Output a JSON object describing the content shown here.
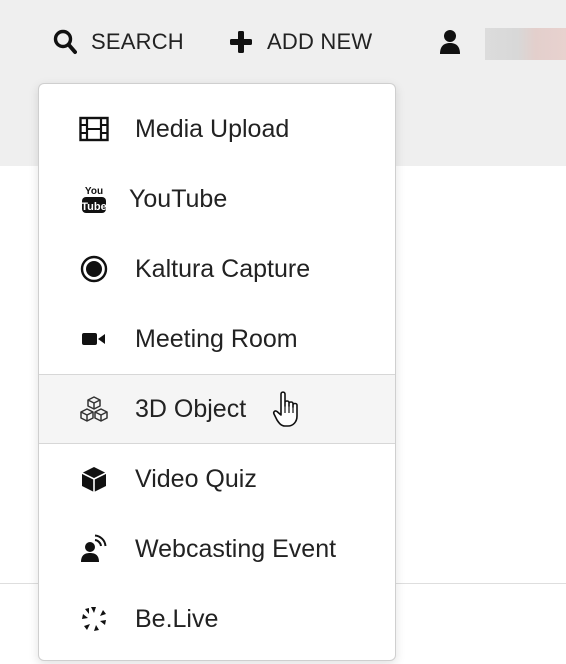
{
  "toolbar": {
    "search_label": "SEARCH",
    "add_new_label": "ADD NEW"
  },
  "menu": {
    "items": [
      {
        "label": "Media Upload",
        "icon": "film-icon"
      },
      {
        "label": "YouTube",
        "icon": "youtube-icon"
      },
      {
        "label": "Kaltura Capture",
        "icon": "record-icon"
      },
      {
        "label": "Meeting Room",
        "icon": "video-camera-icon"
      },
      {
        "label": "3D Object",
        "icon": "cubes-icon"
      },
      {
        "label": "Video Quiz",
        "icon": "cube-icon"
      },
      {
        "label": "Webcasting Event",
        "icon": "broadcast-user-icon"
      },
      {
        "label": "Be.Live",
        "icon": "spinner-icon"
      }
    ],
    "hovered_index": 4
  },
  "colors": {
    "text": "#222222",
    "header_bg": "#efefef",
    "hover_bg": "#f5f5f5",
    "border": "#cfcfcf"
  }
}
